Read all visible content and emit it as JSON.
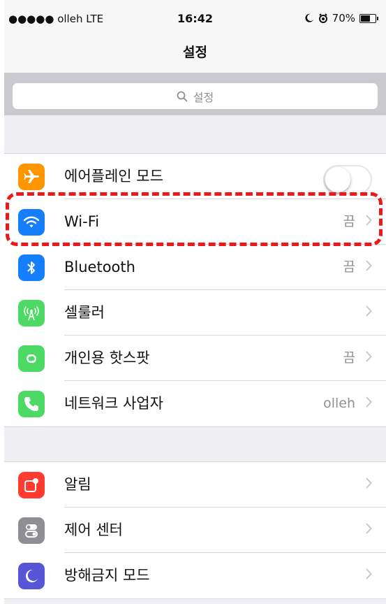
{
  "status_bar": {
    "carrier": "●●●●● olleh  LTE",
    "time": "16:42",
    "battery": "70%",
    "battery_level": 0.7
  },
  "nav": {
    "title": "설정"
  },
  "search": {
    "placeholder": "설정"
  },
  "groups": [
    {
      "rows": [
        {
          "id": "airplane",
          "label": "에어플레인 모드",
          "icon": "airplane-icon",
          "color": "#ff9500",
          "control": "toggle",
          "toggle_on": false
        },
        {
          "id": "wifi",
          "label": "Wi-Fi",
          "value": "끔",
          "icon": "wifi-icon",
          "color": "#147efb",
          "highlighted": true
        },
        {
          "id": "bluetooth",
          "label": "Bluetooth",
          "value": "끔",
          "icon": "bluetooth-icon",
          "color": "#147efb"
        },
        {
          "id": "cellular",
          "label": "셀룰러",
          "icon": "cellular-antenna-icon",
          "color": "#4cd964"
        },
        {
          "id": "hotspot",
          "label": "개인용 핫스팟",
          "value": "끔",
          "icon": "hotspot-chain-icon",
          "color": "#4cd964"
        },
        {
          "id": "carrier",
          "label": "네트워크 사업자",
          "value": "olleh",
          "icon": "phone-icon",
          "color": "#4cd964"
        }
      ]
    },
    {
      "rows": [
        {
          "id": "notifications",
          "label": "알림",
          "icon": "notifications-icon",
          "color": "#ff3b30"
        },
        {
          "id": "control-center",
          "label": "제어 센터",
          "icon": "control-center-icon",
          "color": "#8e8e93"
        },
        {
          "id": "do-not-disturb",
          "label": "방해금지 모드",
          "icon": "moon-icon",
          "color": "#5856d6"
        }
      ]
    }
  ],
  "colors": {
    "highlight": "#ea1a1a",
    "background": "#efeff4"
  }
}
